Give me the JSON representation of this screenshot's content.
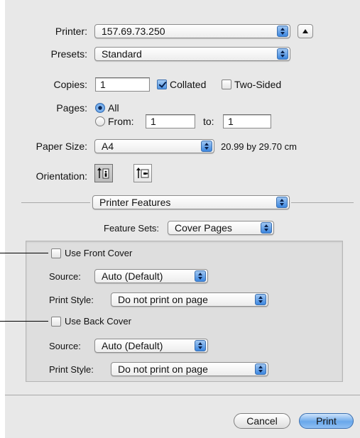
{
  "printer": {
    "label": "Printer:",
    "value": "157.69.73.250"
  },
  "presets": {
    "label": "Presets:",
    "value": "Standard"
  },
  "copies": {
    "label": "Copies:",
    "value": "1",
    "collated_label": "Collated",
    "collated": true,
    "two_sided_label": "Two-Sided",
    "two_sided": false
  },
  "pages": {
    "label": "Pages:",
    "all_label": "All",
    "from_label": "From:",
    "from_value": "1",
    "to_label": "to:",
    "to_value": "1",
    "selected": "All"
  },
  "paper_size": {
    "label": "Paper Size:",
    "value": "A4",
    "dimensions": "20.99 by 29.70 cm"
  },
  "orientation": {
    "label": "Orientation:",
    "selected": "portrait"
  },
  "panel_popup": {
    "value": "Printer Features"
  },
  "feature_sets": {
    "label": "Feature Sets:",
    "value": "Cover Pages"
  },
  "front_cover": {
    "checkbox_label": "Use Front Cover",
    "checked": false,
    "source_label": "Source:",
    "source_value": "Auto (Default)",
    "print_style_label": "Print Style:",
    "print_style_value": "Do not print on page"
  },
  "back_cover": {
    "checkbox_label": "Use Back Cover",
    "checked": false,
    "source_label": "Source:",
    "source_value": "Auto (Default)",
    "print_style_label": "Print Style:",
    "print_style_value": "Do not print on page"
  },
  "buttons": {
    "cancel": "Cancel",
    "print": "Print"
  },
  "colors": {
    "accent": "#4f94e3",
    "dialog_bg": "#e8e8e8",
    "inset_bg": "#dedede"
  }
}
